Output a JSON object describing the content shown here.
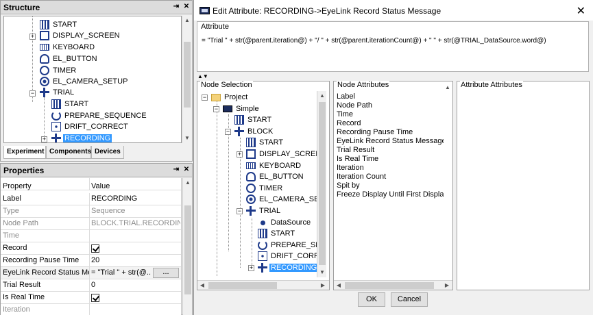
{
  "structure": {
    "title": "Structure",
    "pin_icon": "pin-icon",
    "close_icon": "close-icon",
    "tree": [
      {
        "label": "START",
        "icon": "start-icon"
      },
      {
        "label": "DISPLAY_SCREEN",
        "icon": "screen-icon"
      },
      {
        "label": "KEYBOARD",
        "icon": "keyboard-icon"
      },
      {
        "label": "EL_BUTTON",
        "icon": "button-icon"
      },
      {
        "label": "TIMER",
        "icon": "timer-icon"
      },
      {
        "label": "EL_CAMERA_SETUP",
        "icon": "camera-icon"
      },
      {
        "label": "TRIAL",
        "icon": "trial-icon"
      },
      {
        "label": "START",
        "icon": "start-icon"
      },
      {
        "label": "PREPARE_SEQUENCE",
        "icon": "prepare-icon"
      },
      {
        "label": "DRIFT_CORRECT",
        "icon": "drift-icon"
      },
      {
        "label": "RECORDING",
        "icon": "recording-icon",
        "selected": true
      }
    ],
    "tabs": [
      "Experiment",
      "Components",
      "Devices"
    ]
  },
  "properties": {
    "title": "Properties",
    "columns": [
      "Property",
      "Value"
    ],
    "rows": [
      {
        "key": "Label",
        "value": "RECORDING"
      },
      {
        "key": "Type",
        "value": "Sequence",
        "dim": true
      },
      {
        "key": "Node Path",
        "value": "BLOCK.TRIAL.RECORDING",
        "dim": true
      },
      {
        "key": "Time",
        "value": "",
        "dim": true
      },
      {
        "key": "Record",
        "value": "",
        "checkbox": true
      },
      {
        "key": "Recording Pause Time",
        "value": "20"
      },
      {
        "key": "EyeLink Record Status Mes...",
        "value": "= \"Trial \" + str(@...",
        "button": "..."
      },
      {
        "key": "Trial Result",
        "value": "0"
      },
      {
        "key": "Is Real Time",
        "value": "",
        "checkbox": true
      },
      {
        "key": "Iteration",
        "value": "",
        "dim": true
      }
    ]
  },
  "dialog": {
    "title": "Edit Attribute: RECORDING->EyeLink Record Status Message",
    "close_glyph": "✕",
    "attribute_caption": "Attribute",
    "attribute_expression": "= \"Trial \" + str(@parent.iteration@) + \"/ \" + str(@parent.iterationCount@) + \" \" + str(@TRIAL_DataSource.word@)",
    "node_selection_caption": "Node Selection",
    "node_tree": [
      {
        "label": "Project",
        "icon": "folder-icon"
      },
      {
        "label": "Simple",
        "icon": "simple-icon"
      },
      {
        "label": "START",
        "icon": "start-icon"
      },
      {
        "label": "BLOCK",
        "icon": "trial-icon"
      },
      {
        "label": "START",
        "icon": "start-icon"
      },
      {
        "label": "DISPLAY_SCREEN",
        "icon": "screen-icon"
      },
      {
        "label": "KEYBOARD",
        "icon": "keyboard-icon"
      },
      {
        "label": "EL_BUTTON",
        "icon": "button-icon"
      },
      {
        "label": "TIMER",
        "icon": "timer-icon"
      },
      {
        "label": "EL_CAMERA_SETUP",
        "icon": "camera-icon"
      },
      {
        "label": "TRIAL",
        "icon": "trial-icon"
      },
      {
        "label": "DataSource",
        "icon": "datasource-icon"
      },
      {
        "label": "START",
        "icon": "start-icon"
      },
      {
        "label": "PREPARE_SEQUENCE",
        "icon": "prepare-icon"
      },
      {
        "label": "DRIFT_CORRECT",
        "icon": "drift-icon"
      },
      {
        "label": "RECORDING",
        "icon": "recording-icon",
        "selected": true
      }
    ],
    "node_attributes_caption": "Node Attributes",
    "node_attributes": [
      "Label",
      "Node Path",
      "Time",
      "Record",
      "Recording Pause Time",
      "EyeLink Record Status Message",
      "Trial Result",
      "Is Real Time",
      "Iteration",
      "Iteration Count",
      "Spit by",
      "Freeze Display Until First Display Screen"
    ],
    "attribute_attributes_caption": "Attribute Attributes",
    "ok_label": "OK",
    "cancel_label": "Cancel"
  },
  "colors": {
    "selection": "#3399ff",
    "icon_blue": "#1e3a8a"
  }
}
